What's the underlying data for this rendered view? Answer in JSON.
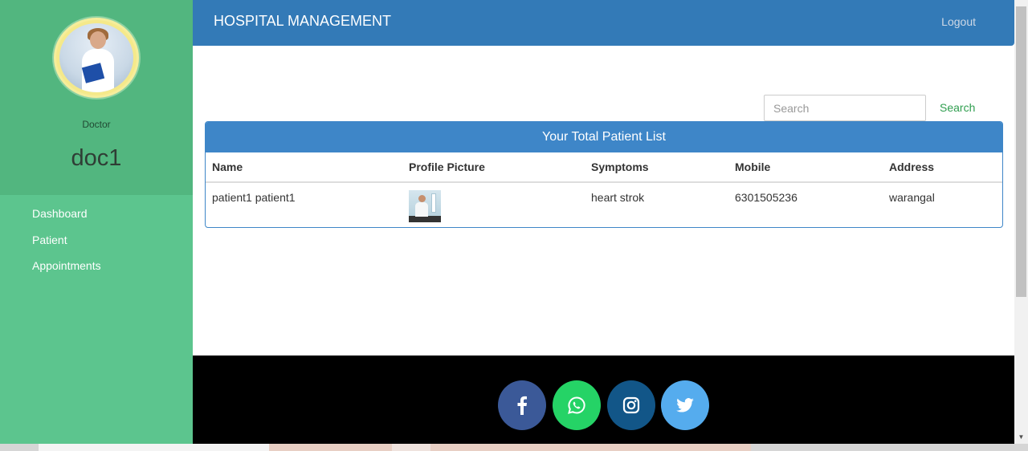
{
  "header": {
    "brand": "HOSPITAL MANAGEMENT",
    "logout_label": "Logout"
  },
  "sidebar": {
    "role": "Doctor",
    "user_name": "doc1",
    "items": [
      {
        "label": "Dashboard"
      },
      {
        "label": "Patient"
      },
      {
        "label": "Appointments"
      }
    ]
  },
  "search": {
    "placeholder": "Search",
    "button_label": "Search"
  },
  "panel": {
    "title": "Your Total Patient List",
    "columns": [
      "Name",
      "Profile Picture",
      "Symptoms",
      "Mobile",
      "Address"
    ],
    "rows": [
      {
        "name": "patient1 patient1",
        "symptoms": "heart strok",
        "mobile": "6301505236",
        "address": "warangal"
      }
    ]
  },
  "footer": {
    "social": [
      {
        "icon": "facebook-icon",
        "color": "#3b5998"
      },
      {
        "icon": "whatsapp-icon",
        "color": "#25d366"
      },
      {
        "icon": "instagram-icon",
        "color": "#125688"
      },
      {
        "icon": "twitter-icon",
        "color": "#55acee"
      }
    ]
  },
  "colors": {
    "header": "#337ab7",
    "sidebar": "#5cc58e",
    "sidebar_top": "#52b67f",
    "panel": "#3e86c8",
    "search_button": "#2f9e4f"
  }
}
